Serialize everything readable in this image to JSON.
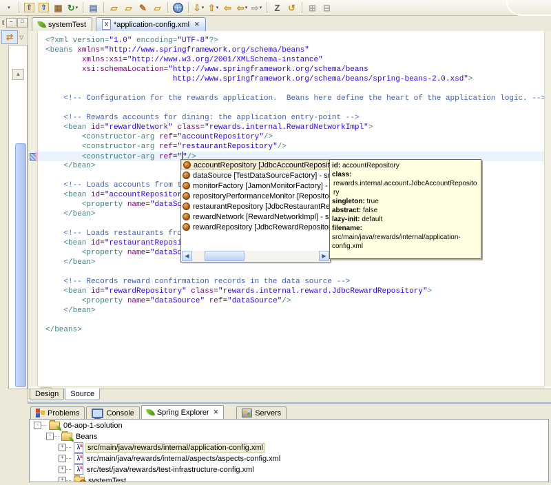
{
  "colors": {
    "tag": "#3F7F7F",
    "attr": "#7F007F",
    "value": "#2A00FF",
    "comment": "#3F5FBF",
    "text": "#000000"
  },
  "toolbar": {
    "items": [
      {
        "t": "dd",
        "name": "toolbar-group-dropdown"
      },
      {
        "t": "sep"
      },
      {
        "t": "btn",
        "name": "new-wizard-icon",
        "glyph": "⇧",
        "fg": "#3355AA",
        "boxed": true
      },
      {
        "t": "btn",
        "name": "new-wizard-alt-icon",
        "glyph": "⇧",
        "fg": "#3355AA",
        "boxed": true
      },
      {
        "t": "btn",
        "name": "java-package-icon",
        "glyph": "▦",
        "fg": "#A5682A"
      },
      {
        "t": "btn",
        "name": "refresh-icon",
        "glyph": "↻",
        "fg": "#2E8B2E",
        "dd": true
      },
      {
        "t": "sep"
      },
      {
        "t": "btn",
        "name": "form-page-icon",
        "glyph": "▤",
        "fg": "#6080C0"
      },
      {
        "t": "sep"
      },
      {
        "t": "btn",
        "name": "import-folder-icon",
        "glyph": "▱",
        "fg": "#B08830"
      },
      {
        "t": "btn",
        "name": "export-folder-icon",
        "glyph": "▱",
        "fg": "#C89838"
      },
      {
        "t": "btn",
        "name": "marker-pen-icon",
        "glyph": "✎",
        "fg": "#B06820"
      },
      {
        "t": "btn",
        "name": "open-folder-icon",
        "glyph": "▱",
        "fg": "#C89838"
      },
      {
        "t": "sep"
      },
      {
        "t": "btn",
        "name": "web-browser-icon",
        "globe": true
      },
      {
        "t": "sep"
      },
      {
        "t": "btn",
        "name": "next-annotation-icon",
        "glyph": "⇩",
        "fg": "#C89020",
        "dd": true
      },
      {
        "t": "btn",
        "name": "previous-annotation-icon",
        "glyph": "⇧",
        "fg": "#C89020",
        "dd": true
      },
      {
        "t": "btn",
        "name": "last-edit-location-icon",
        "glyph": "⇦",
        "fg": "#C89020"
      },
      {
        "t": "btn",
        "name": "back-icon",
        "glyph": "⇦",
        "fg": "#C89020",
        "dd": true
      },
      {
        "t": "btn",
        "name": "forward-icon",
        "glyph": "⇨",
        "fg": "#AAA49A",
        "dd": true,
        "disabled": true
      },
      {
        "t": "sep"
      },
      {
        "t": "btn",
        "name": "external-tools-icon",
        "glyph": "Z",
        "fg": "#555555"
      },
      {
        "t": "btn",
        "name": "refresh-config-icon",
        "glyph": "↺",
        "fg": "#C89020"
      },
      {
        "t": "sep"
      },
      {
        "t": "btn",
        "name": "expand-all-icon",
        "glyph": "⊞",
        "fg": "#9A968C",
        "disabled": true
      },
      {
        "t": "btn",
        "name": "collapse-all-icon",
        "glyph": "⊟",
        "fg": "#9A968C",
        "disabled": true
      }
    ]
  },
  "left_strip": {
    "mini_tab_label": "t",
    "minimize_glyph": "–",
    "maximize_glyph": "□",
    "link_editor_glyph": "⇄",
    "view_menu_glyph": "▽",
    "scroll_up_glyph": "▲"
  },
  "editor": {
    "tabs": [
      {
        "label": "systemTest",
        "icon": "spring-leaf"
      },
      {
        "label": "*application-config.xml",
        "icon": "xml-file",
        "active": true,
        "close_glyph": "✕"
      }
    ],
    "hscroll_left_glyph": "◀",
    "cursor_line": 12,
    "lines": [
      [
        [
          "t",
          "<?xml version="
        ],
        [
          "v",
          "\"1.0\""
        ],
        [
          "t",
          " encoding="
        ],
        [
          "v",
          "\"UTF-8\""
        ],
        [
          "t",
          "?>"
        ]
      ],
      [
        [
          "t",
          "<beans "
        ],
        [
          "a",
          "xmlns"
        ],
        [
          "p",
          "="
        ],
        [
          "v",
          "\"http://www.springframework.org/schema/beans\""
        ]
      ],
      [
        [
          "p",
          "        "
        ],
        [
          "a",
          "xmlns:xsi"
        ],
        [
          "p",
          "="
        ],
        [
          "v",
          "\"http://www.w3.org/2001/XMLSchema-instance\""
        ]
      ],
      [
        [
          "p",
          "        "
        ],
        [
          "a",
          "xsi:schemaLocation"
        ],
        [
          "p",
          "="
        ],
        [
          "v",
          "\"http://www.springframework.org/schema/beans"
        ]
      ],
      [
        [
          "v",
          "                            http://www.springframework.org/schema/beans/spring-beans-2.0.xsd\""
        ],
        [
          "t",
          ">"
        ]
      ],
      [],
      [
        [
          "c",
          "    <!-- Configuration for the rewards application.  Beans here define the heart of the application logic. -->"
        ]
      ],
      [],
      [
        [
          "c",
          "    <!-- Rewards accounts for dining: the application entry-point -->"
        ]
      ],
      [
        [
          "p",
          "    "
        ],
        [
          "t",
          "<bean "
        ],
        [
          "a",
          "id"
        ],
        [
          "p",
          "="
        ],
        [
          "v",
          "\"rewardNetwork\""
        ],
        [
          "p",
          " "
        ],
        [
          "a",
          "class"
        ],
        [
          "p",
          "="
        ],
        [
          "v",
          "\"rewards.internal.RewardNetworkImpl\""
        ],
        [
          "t",
          ">"
        ]
      ],
      [
        [
          "p",
          "        "
        ],
        [
          "t",
          "<constructor-arg "
        ],
        [
          "a",
          "ref"
        ],
        [
          "p",
          "="
        ],
        [
          "v",
          "\"accountRepository\""
        ],
        [
          "t",
          "/>"
        ]
      ],
      [
        [
          "p",
          "        "
        ],
        [
          "t",
          "<constructor-arg "
        ],
        [
          "a",
          "ref"
        ],
        [
          "p",
          "="
        ],
        [
          "v",
          "\"restaurantRepository\""
        ],
        [
          "t",
          "/>"
        ]
      ],
      [
        [
          "p",
          "        "
        ],
        [
          "t",
          "<constructor-arg "
        ],
        [
          "a",
          "ref"
        ],
        [
          "p",
          "="
        ],
        [
          "v",
          "\""
        ],
        [
          "u",
          ""
        ],
        [
          "v",
          "\""
        ],
        [
          "t",
          "/>"
        ]
      ],
      [
        [
          "p",
          "    "
        ],
        [
          "t",
          "</bean>"
        ]
      ],
      [],
      [
        [
          "c",
          "    <!-- Loads accounts from t"
        ]
      ],
      [
        [
          "p",
          "    "
        ],
        [
          "t",
          "<bean "
        ],
        [
          "a",
          "id"
        ],
        [
          "p",
          "="
        ],
        [
          "v",
          "\"accountRepositor"
        ]
      ],
      [
        [
          "p",
          "        "
        ],
        [
          "t",
          "<property "
        ],
        [
          "a",
          "name"
        ],
        [
          "p",
          "="
        ],
        [
          "v",
          "\"dataSo"
        ]
      ],
      [
        [
          "p",
          "    "
        ],
        [
          "t",
          "</bean>"
        ]
      ],
      [],
      [
        [
          "c",
          "    <!-- Loads restaurants fro"
        ]
      ],
      [
        [
          "p",
          "    "
        ],
        [
          "t",
          "<bean "
        ],
        [
          "a",
          "id"
        ],
        [
          "p",
          "="
        ],
        [
          "v",
          "\"restaurantReposi"
        ]
      ],
      [
        [
          "p",
          "        "
        ],
        [
          "t",
          "<property "
        ],
        [
          "a",
          "name"
        ],
        [
          "p",
          "="
        ],
        [
          "v",
          "\"dataSo"
        ]
      ],
      [
        [
          "p",
          "    "
        ],
        [
          "t",
          "</bean>"
        ]
      ],
      [],
      [
        [
          "c",
          "    <!-- Records reward confirmation records in the data source -->"
        ]
      ],
      [
        [
          "p",
          "    "
        ],
        [
          "t",
          "<bean "
        ],
        [
          "a",
          "id"
        ],
        [
          "p",
          "="
        ],
        [
          "v",
          "\"rewardRepository\""
        ],
        [
          "p",
          " "
        ],
        [
          "a",
          "class"
        ],
        [
          "p",
          "="
        ],
        [
          "v",
          "\"rewards.internal.reward.JdbcRewardRepository\""
        ],
        [
          "t",
          ">"
        ]
      ],
      [
        [
          "p",
          "        "
        ],
        [
          "t",
          "<property "
        ],
        [
          "a",
          "name"
        ],
        [
          "p",
          "="
        ],
        [
          "v",
          "\"dataSource\""
        ],
        [
          "p",
          " "
        ],
        [
          "a",
          "ref"
        ],
        [
          "p",
          "="
        ],
        [
          "v",
          "\"dataSource\""
        ],
        [
          "t",
          "/>"
        ]
      ],
      [
        [
          "p",
          "    "
        ],
        [
          "t",
          "</bean>"
        ]
      ],
      [],
      [
        [
          "t",
          "</beans>"
        ]
      ]
    ]
  },
  "content_assist": {
    "items": [
      {
        "label": "accountRepository [JdbcAccountRepository] - src",
        "selected": true
      },
      {
        "label": "dataSource [TestDataSourceFactory] - src/test/ja"
      },
      {
        "label": "monitorFactory [JamonMonitorFactory] - src/main"
      },
      {
        "label": "repositoryPerformanceMonitor [RepositoryPerform"
      },
      {
        "label": "restaurantRepository [JdbcRestaurantRepository"
      },
      {
        "label": "rewardNetwork [RewardNetworkImpl] - src/main/j"
      },
      {
        "label": "rewardRepository [JdbcRewardRepository] - src/r"
      }
    ],
    "scroll_left_glyph": "◀",
    "scroll_right_glyph": "▶"
  },
  "bean_tooltip": {
    "rows": [
      {
        "label": "id:",
        "value": " accountRepository"
      },
      {
        "label": "class:",
        "value": "rewards.internal.account.JdbcAccountRepository",
        "block": true
      },
      {
        "label": "singleton:",
        "value": " true"
      },
      {
        "label": "abstract:",
        "value": " false"
      },
      {
        "label": "lazy-init:",
        "value": " default"
      },
      {
        "label": "filename:",
        "value": " src/main/java/rewards/internal/application-config.xml"
      }
    ]
  },
  "page_tabs": {
    "tabs": [
      {
        "label": "Design"
      },
      {
        "label": "Source",
        "active": true
      }
    ]
  },
  "bottom": {
    "tabs": [
      {
        "label": "Problems",
        "icon": "problems"
      },
      {
        "label": "Console",
        "icon": "console"
      },
      {
        "label": "Spring Explorer",
        "icon": "spring-leaf",
        "active": true,
        "close_glyph": "✕"
      },
      {
        "label": "Servers",
        "icon": "servers",
        "gap": true
      }
    ],
    "tree": [
      {
        "level": 0,
        "toggle": "-",
        "icon": "spring-project",
        "label": "06-aop-1-solution"
      },
      {
        "level": 1,
        "toggle": "-",
        "icon": "beans-folder",
        "label": "Beans"
      },
      {
        "level": 2,
        "toggle": "+",
        "icon": "beans-config",
        "label": "src/main/java/rewards/internal/application-config.xml",
        "selected": true
      },
      {
        "level": 2,
        "toggle": "+",
        "icon": "beans-config",
        "label": "src/main/java/rewards/internal/aspects/aspects-config.xml"
      },
      {
        "level": 2,
        "toggle": "+",
        "icon": "beans-config",
        "label": "src/test/java/rewards/test-infrastructure-config.xml"
      },
      {
        "level": 2,
        "toggle": "+",
        "icon": "systemtest-folder",
        "label": "systemTest"
      }
    ],
    "config_badge": "λ",
    "config_badge_sup": "S"
  }
}
